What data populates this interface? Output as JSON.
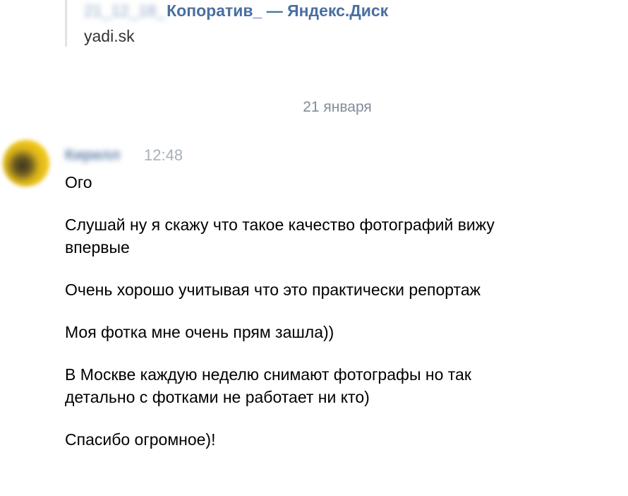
{
  "link_preview": {
    "title_prefix": "21_12_18_",
    "title": "Копоратив_ — Яндекс.Диск",
    "domain": "yadi.sk"
  },
  "date_divider": "21 января",
  "message": {
    "sender": "Кирилл",
    "time": "12:48",
    "paragraphs": [
      [
        "Ого"
      ],
      [
        "Слушай ну я скажу что такое качество фотографий вижу",
        "впервые"
      ],
      [
        "Очень хорошо учитывая что это практически репортаж"
      ],
      [
        "Моя фотка мне очень прям зашла))"
      ],
      [
        "В Москве каждую неделю снимают фотографы но так",
        "детально с фотками не работает ни кто)"
      ],
      [
        "Спасибо огромное)!"
      ]
    ]
  }
}
